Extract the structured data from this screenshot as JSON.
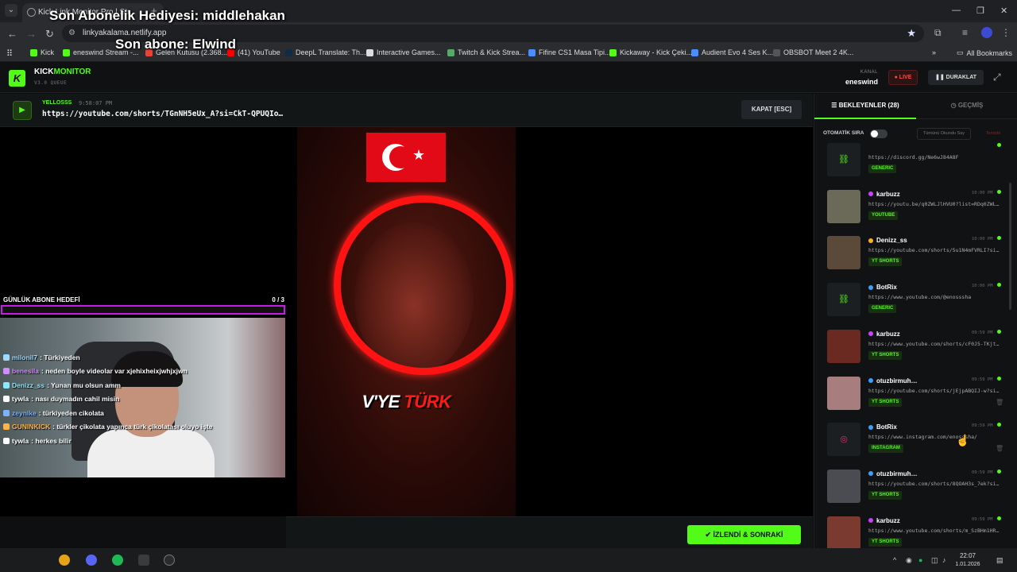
{
  "browser": {
    "tab_title": "Kick Link Monitor Pro | Str...",
    "url": "linkyakalama.netlify.app",
    "bookmarks": [
      "Kick",
      "eneswind Stream -...",
      "Gelen Kutusu (2.368...",
      "(41) YouTube",
      "DeepL Translate: Th...",
      "Interactive Games...",
      "Twitch & Kick Strea...",
      "Fifine CS1 Masa Tipi...",
      "Kickaway - Kick Çeki...",
      "Audient Evo 4 Ses K...",
      "OBSBOT Meet 2 4K..."
    ],
    "all_bookmarks": "All Bookmarks"
  },
  "overlay": {
    "gift_sub": "Son Abonelik Hediyesi: middlehakan",
    "last_sub": "Son abone: Elwind"
  },
  "header": {
    "logo_letter": "K",
    "logo_part1": "KICK",
    "logo_part2": "MONITOR",
    "logo_sub": "V3.0 QUEUE",
    "channel_label": "KANAL",
    "channel_name": "eneswind",
    "live_label": "● LIVE",
    "pause_label": "❚❚ DURAKLAT"
  },
  "now_playing": {
    "user": "YELLOSSS",
    "time": "9:58:07 PM",
    "url": "https://youtube.com/shorts/TGnNH5eUx_A?si=CkT-QPUQIo…",
    "close_label": "KAPAT [ESC]"
  },
  "video": {
    "caption_white": "V'YE",
    "caption_red": "TÜRK"
  },
  "goal": {
    "label": "GÜNLÜK ABONE HEDEFİ",
    "count": "0  / 3",
    "progress": 0
  },
  "chat": [
    {
      "user": "milonil7",
      "color": "#9fd9ff",
      "text": ": Türkiyeden"
    },
    {
      "user": "benesila",
      "color": "#d38cff",
      "text": ": neden boyle videolar var xjehixheixjwhjxjwn"
    },
    {
      "user": "Denizz_ss",
      "color": "#8ce6ff",
      "text": ": Yunan mu olsun amm"
    },
    {
      "user": "tywla",
      "color": "#ffffff",
      "text": ": nası duymadın cahil misin"
    },
    {
      "user": "zeynike",
      "color": "#7fb0ff",
      "text": ": türkiyeden cikolata"
    },
    {
      "user": "GUNINKICK",
      "color": "#ffb347",
      "text": ": türkler çikolata yapınca türk çikolatası oluyo işte"
    },
    {
      "user": "tywla",
      "color": "#ffffff",
      "text": ": herkes bilir"
    }
  ],
  "next_button": "✔ İZLENDİ & SONRAKİ",
  "panel": {
    "tab_queue": "☰  BEKLEYENLER (28)",
    "tab_history": "◷  GEÇMİŞ",
    "auto_label": "OTOMATİK SIRA",
    "mark_read": "Tümünü Okundu Say",
    "clear": "Temizle",
    "items": [
      {
        "user": "",
        "dot": "",
        "time": "",
        "url": "https://discord.gg/Ne6wJ84A8F",
        "tag": "GENERIC",
        "thumb": "#1c1f21"
      },
      {
        "user": "karbuzz",
        "dot": "#c940ff",
        "time": "10:00 PM",
        "url": "https://youtu.be/q0ZWLJlHVU0?list=RDq0ZWL…",
        "tag": "YOUTUBE",
        "thumb": "#6b6a58"
      },
      {
        "user": "Denizz_ss",
        "dot": "#ffb020",
        "time": "10:00 PM",
        "url": "https://youtube.com/shorts/5u1N4mFVRLI?si…",
        "tag": "YT SHORTS",
        "thumb": "#5b4a3a"
      },
      {
        "user": "BotRix",
        "dot": "#3aa0ff",
        "time": "10:00 PM",
        "url": "https://www.youtube.com/@enosssha",
        "tag": "GENERIC",
        "thumb": "#1c1f21"
      },
      {
        "user": "karbuzz",
        "dot": "#c940ff",
        "time": "09:59 PM",
        "url": "https://www.youtube.com/shorts/cF0J5-TKjt…",
        "tag": "YT SHORTS",
        "thumb": "#6a2a22"
      },
      {
        "user": "otuzbirmuh…",
        "dot": "#3aa0ff",
        "time": "09:59 PM",
        "url": "https://youtube.com/shorts/jEjpABQIJ-w?si…",
        "tag": "YT SHORTS",
        "thumb": "#a87d7d"
      },
      {
        "user": "BotRix",
        "dot": "#3aa0ff",
        "time": "09:59 PM",
        "url": "https://www.instagram.com/enosssha/",
        "tag": "INSTAGRAM",
        "thumb": "#1c1f21"
      },
      {
        "user": "otuzbirmuh…",
        "dot": "#3aa0ff",
        "time": "09:59 PM",
        "url": "https://youtube.com/shorts/8QOAH3s_7ek?si…",
        "tag": "YT SHORTS",
        "thumb": "#4a4c52"
      },
      {
        "user": "karbuzz",
        "dot": "#c940ff",
        "time": "09:59 PM",
        "url": "https://www.youtube.com/shorts/m_SzBHm1HR…",
        "tag": "YT SHORTS",
        "thumb": "#7a3a30"
      }
    ]
  },
  "taskbar": {
    "time": "22:07",
    "date": "1.01.2026"
  },
  "colors": {
    "accent": "#53fc18",
    "goal": "#c51ce6",
    "live": "#ff4b4b"
  }
}
